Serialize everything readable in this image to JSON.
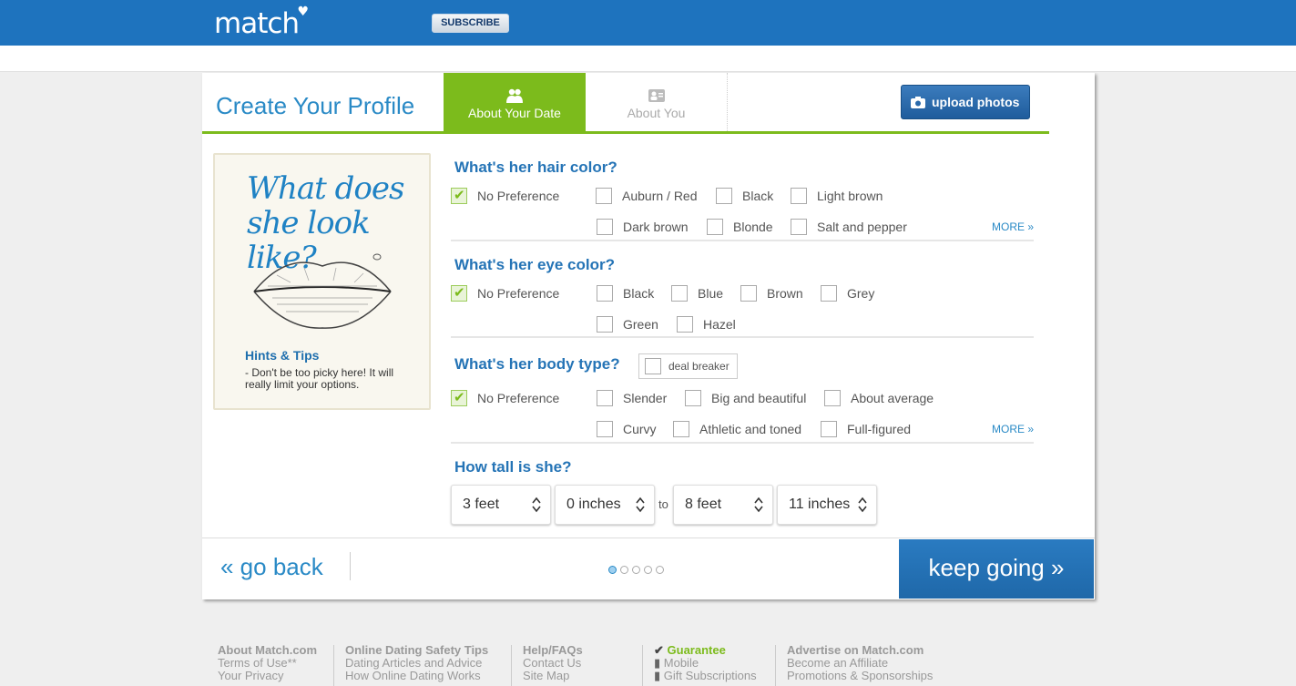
{
  "header": {
    "logo": "match",
    "subscribe_label": "SUBSCRIBE"
  },
  "profile": {
    "title": "Create Your Profile",
    "tabs": [
      {
        "label": "About Your Date",
        "active": true
      },
      {
        "label": "About You",
        "active": false
      }
    ],
    "upload_label": "upload photos"
  },
  "tips": {
    "heading_line1": "What does",
    "heading_line2": "she look like?",
    "title": "Hints & Tips",
    "text": "- Don't be too picky here! It will really limit your options."
  },
  "questions": {
    "hair": {
      "title": "What's her hair color?",
      "options": [
        "No Preference",
        "Auburn / Red",
        "Black",
        "Light brown",
        "Dark brown",
        "Blonde",
        "Salt and pepper"
      ],
      "more": "MORE »"
    },
    "eye": {
      "title": "What's her eye color?",
      "options": [
        "No Preference",
        "Black",
        "Blue",
        "Brown",
        "Grey",
        "Green",
        "Hazel"
      ]
    },
    "body": {
      "title": "What's her body type?",
      "deal_breaker": "deal breaker",
      "options": [
        "No Preference",
        "Slender",
        "Big and beautiful",
        "About average",
        "Curvy",
        "Athletic and toned",
        "Full-figured"
      ],
      "more": "MORE »"
    },
    "height": {
      "title": "How tall is she?",
      "min_feet": "3 feet",
      "min_inches": "0 inches",
      "to": "to",
      "max_feet": "8 feet",
      "max_inches": "11 inches"
    }
  },
  "nav": {
    "back_label": "« go back",
    "next_label": "keep going »",
    "steps_total": 5,
    "step_current": 1
  },
  "footer": {
    "col1": {
      "title": "About Match.com",
      "links": [
        "Terms of Use**",
        "Your Privacy"
      ]
    },
    "col2": {
      "title": "Online Dating Safety Tips",
      "links": [
        "Dating Articles and Advice",
        "How Online Dating Works"
      ]
    },
    "col3": {
      "title": "Help/FAQs",
      "links": [
        "Contact Us",
        "Site Map"
      ]
    },
    "col4": {
      "title": "Guarantee",
      "links": [
        "Mobile",
        "Gift Subscriptions"
      ]
    },
    "col5": {
      "title": "Advertise on Match.com",
      "links": [
        "Become an Affiliate",
        "Promotions & Sponsorships"
      ]
    }
  },
  "colors": {
    "brand_blue": "#1e73be",
    "accent_green": "#7cbb1c",
    "link_blue": "#2a8ac6"
  },
  "icons": {
    "tab_date": "couple-icon",
    "tab_you": "profile-card-icon",
    "upload": "camera-icon",
    "guarantee": "checkmark-icon",
    "mobile": "phone-icon"
  }
}
